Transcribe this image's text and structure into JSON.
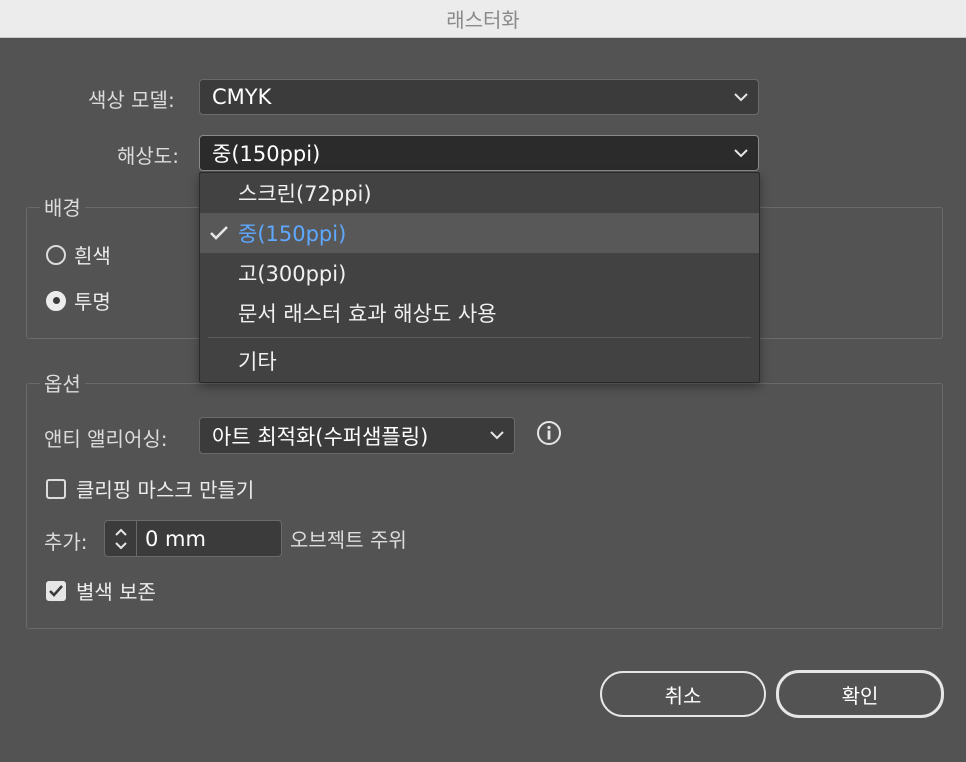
{
  "window": {
    "title": "래스터화"
  },
  "color_model": {
    "label": "색상 모델:",
    "value": "CMYK"
  },
  "resolution": {
    "label": "해상도:",
    "value": "중(150ppi)",
    "options": [
      "스크린(72ppi)",
      "중(150ppi)",
      "고(300ppi)",
      "문서 래스터 효과 해상도 사용",
      "기타"
    ],
    "selected_index": 1
  },
  "background": {
    "legend": "배경",
    "options": [
      {
        "label": "흰색",
        "checked": false
      },
      {
        "label": "투명",
        "checked": true
      }
    ]
  },
  "options": {
    "legend": "옵션",
    "antialias_label": "앤티 앨리어싱:",
    "antialias_value": "아트 최적화(수퍼샘플링)",
    "clipping_mask_label": "클리핑 마스크 만들기",
    "clipping_mask_checked": false,
    "add_label": "추가:",
    "add_value": "0 mm",
    "add_suffix": "오브젝트 주위",
    "preserve_spot_label": "별색 보존",
    "preserve_spot_checked": true
  },
  "buttons": {
    "cancel": "취소",
    "ok": "확인"
  },
  "icons": {
    "info": "info-icon",
    "chevron": "chevron-down-icon",
    "check": "checkmark-icon",
    "stepper": "stepper-arrows-icon"
  },
  "colors": {
    "accent_selected": "#5ea8ff",
    "dialog_bg": "#535353",
    "menu_bg": "#424242"
  }
}
